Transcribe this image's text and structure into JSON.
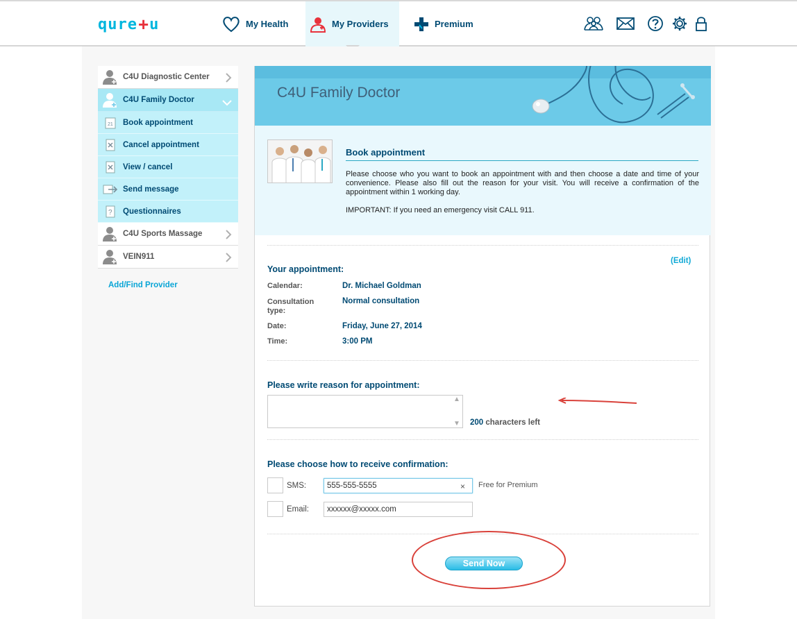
{
  "header": {
    "logo_left": "qure",
    "logo_plus": "+",
    "logo_right": "u",
    "nav": [
      {
        "label": "My Health",
        "icon": "heart-icon"
      },
      {
        "label": "My Providers",
        "icon": "doctor-icon",
        "active": true
      },
      {
        "label": "Premium",
        "icon": "cross-icon"
      }
    ],
    "tools": [
      "family-icon",
      "mail-icon",
      "help-icon",
      "settings-icon",
      "lock-icon"
    ]
  },
  "sidebar": {
    "items": [
      {
        "label": "C4U Diagnostic Center"
      },
      {
        "label": "C4U Family Doctor",
        "active": true
      },
      {
        "label": "C4U Sports Massage"
      },
      {
        "label": "VEIN911"
      }
    ],
    "subitems": [
      {
        "label": "Book appointment",
        "icon": "calendar-icon",
        "icon_text": "21"
      },
      {
        "label": "Cancel appointment",
        "icon": "cancel-doc-icon"
      },
      {
        "label": "View / cancel",
        "icon": "view-doc-icon"
      },
      {
        "label": "Send message",
        "icon": "send-message-icon"
      },
      {
        "label": "Questionnaires",
        "icon": "question-doc-icon"
      }
    ],
    "add_provider": "Add/Find Provider"
  },
  "banner": {
    "title": "C4U Family Doctor"
  },
  "intro": {
    "heading": "Book appointment",
    "text": "Please choose who you want to book an appointment with and then choose a date and time of your convenience. Please also fill out the reason for your visit. You will receive a confirmation of the appointment within 1 working day.",
    "important": "IMPORTANT: If you need an emergency visit CALL 911."
  },
  "appointment": {
    "heading": "Your appointment:",
    "edit": "(Edit)",
    "fields": [
      {
        "label": "Calendar:",
        "value": "Dr. Michael Goldman"
      },
      {
        "label": "Consultation type:",
        "value": "Normal consultation"
      },
      {
        "label": "Date:",
        "value": "Friday, June 27, 2014"
      },
      {
        "label": "Time:",
        "value": "3:00 PM"
      }
    ]
  },
  "reason": {
    "heading": "Please write reason for appointment:",
    "value": "",
    "chars_left_num": "200",
    "chars_left_text": "characters left"
  },
  "confirmation": {
    "heading": "Please choose how to receive confirmation:",
    "sms_label": "SMS:",
    "sms_value": "555-555-5555",
    "sms_note": "Free for Premium",
    "email_label": "Email:",
    "email_value": "xxxxxx@xxxxx.com",
    "clear_glyph": "×"
  },
  "send_button": "Send Now",
  "colors": {
    "accent": "#00b6de",
    "navy": "#004a73",
    "annotation": "#d9413a",
    "brand_red": "#e8323c"
  }
}
